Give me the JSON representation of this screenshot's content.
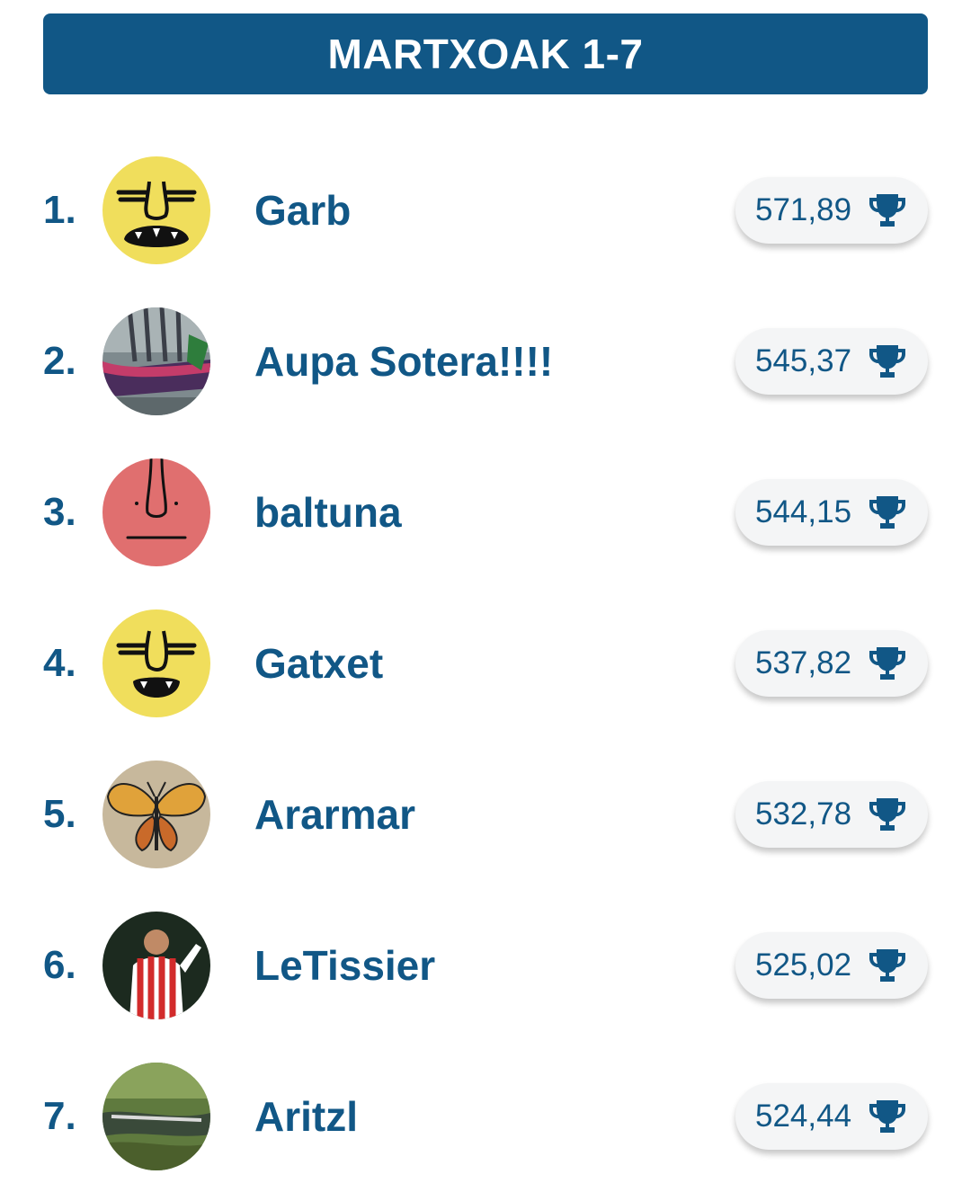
{
  "header": {
    "title": "MARTXOAK 1-7"
  },
  "colors": {
    "brand": "#115786",
    "pill_bg": "#f4f5f6"
  },
  "ranking": [
    {
      "rank": "1.",
      "name": "Garb",
      "score": "571,89",
      "avatar": "yellow-meme-face-icon"
    },
    {
      "rank": "2.",
      "name": "Aupa Sotera!!!!",
      "score": "545,37",
      "avatar": "rowing-boat-photo"
    },
    {
      "rank": "3.",
      "name": "baltuna",
      "score": "544,15",
      "avatar": "pink-face-icon"
    },
    {
      "rank": "4.",
      "name": "Gatxet",
      "score": "537,82",
      "avatar": "yellow-meme-face-icon"
    },
    {
      "rank": "5.",
      "name": "Ararmar",
      "score": "532,78",
      "avatar": "butterfly-photo"
    },
    {
      "rank": "6.",
      "name": "LeTissier",
      "score": "525,02",
      "avatar": "football-player-photo"
    },
    {
      "rank": "7.",
      "name": "Aritzl",
      "score": "524,44",
      "avatar": "forest-river-photo"
    }
  ],
  "score_icon": "trophy-icon"
}
